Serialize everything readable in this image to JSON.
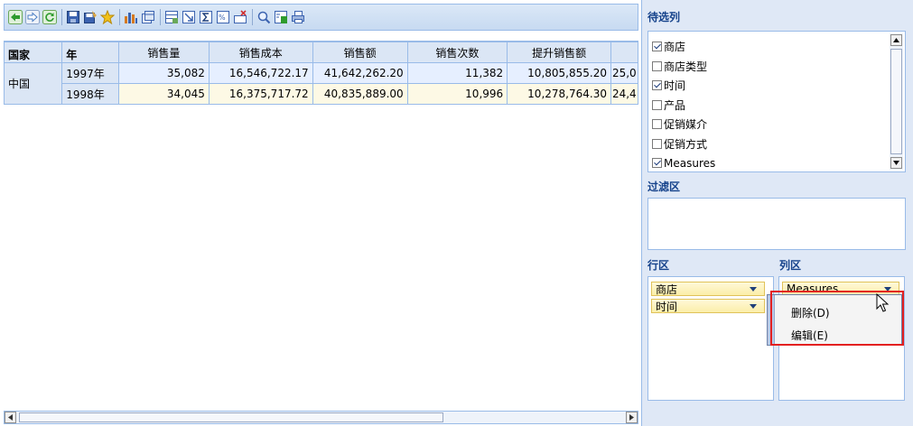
{
  "toolbar": {
    "buttons": [
      {
        "name": "back-icon",
        "color": "#2e9b2e"
      },
      {
        "name": "forward-icon",
        "color": "#4a7dc4"
      },
      {
        "name": "refresh-icon",
        "color": "#2e9b2e"
      },
      {
        "name": "save-icon",
        "color": "#3b63b0"
      },
      {
        "name": "save-as-icon",
        "color": "#3b63b0"
      },
      {
        "name": "favorite-star-icon",
        "color": "#f2c21a"
      },
      {
        "name": "chart-icon",
        "color": "#d77a1f"
      },
      {
        "name": "pivot-icon",
        "color": "#3b63b0"
      },
      {
        "name": "filter-icon",
        "color": "#3b63b0"
      },
      {
        "name": "drill-icon",
        "color": "#3b63b0"
      },
      {
        "name": "sum-icon",
        "color": "#3b63b0"
      },
      {
        "name": "format-icon",
        "color": "#3b63b0"
      },
      {
        "name": "delete-empty-icon",
        "color": "#d03030"
      },
      {
        "name": "search-icon",
        "color": "#3b63b0"
      },
      {
        "name": "export-excel-icon",
        "color": "#2e9b2e"
      },
      {
        "name": "print-icon",
        "color": "#3b63b0"
      }
    ]
  },
  "grid": {
    "row_headers": {
      "country": "国家",
      "year": "年"
    },
    "columns": [
      "销售量",
      "销售成本",
      "销售额",
      "销售次数",
      "提升销售额"
    ],
    "overflow_column": "25,0",
    "rows": [
      {
        "country": "中国",
        "year": "1997年",
        "values": [
          "35,082",
          "16,546,722.17",
          "41,642,262.20",
          "11,382",
          "10,805,855.20"
        ],
        "overflow": "25,0"
      },
      {
        "year": "1998年",
        "values": [
          "34,045",
          "16,375,717.72",
          "40,835,889.00",
          "10,996",
          "10,278,764.30"
        ],
        "overflow": "24,4"
      }
    ]
  },
  "right_panel": {
    "field_list": {
      "title": "待选列",
      "items": [
        {
          "label": "商店",
          "checked": true
        },
        {
          "label": "商店类型",
          "checked": false
        },
        {
          "label": "时间",
          "checked": true
        },
        {
          "label": "产品",
          "checked": false
        },
        {
          "label": "促销媒介",
          "checked": false
        },
        {
          "label": "促销方式",
          "checked": false
        },
        {
          "label": "Measures",
          "checked": true
        }
      ]
    },
    "filter_area": {
      "title": "过滤区"
    },
    "row_area": {
      "title": "行区",
      "chips": [
        "商店",
        "时间"
      ]
    },
    "column_area": {
      "title": "列区",
      "chips": [
        "Measures"
      ]
    }
  },
  "context_menu": {
    "items": [
      {
        "label": "删除(D)"
      },
      {
        "label": "编辑(E)"
      }
    ],
    "highlight_color": "#e32020"
  }
}
